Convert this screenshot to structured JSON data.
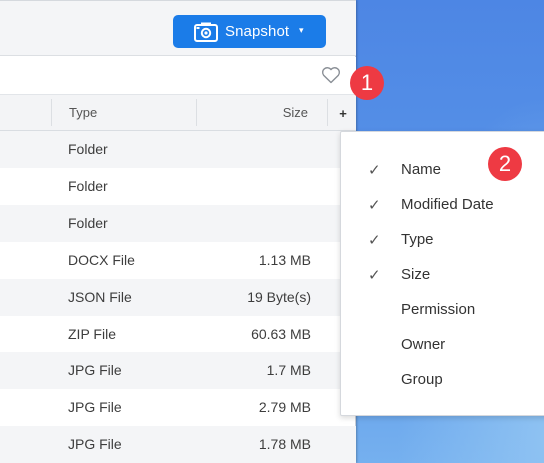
{
  "toolbar": {
    "snapshot_label": "Snapshot",
    "snapshot_icon": "camera-icon",
    "caret": "▾"
  },
  "filterbar": {
    "favorite_icon": "heart-icon"
  },
  "columns": {
    "type": "Type",
    "size": "Size",
    "add": "+"
  },
  "rows": [
    {
      "type": "Folder",
      "size": ""
    },
    {
      "type": "Folder",
      "size": ""
    },
    {
      "type": "Folder",
      "size": ""
    },
    {
      "type": "DOCX File",
      "size": "1.13 MB"
    },
    {
      "type": "JSON File",
      "size": "19 Byte(s)"
    },
    {
      "type": "ZIP File",
      "size": "60.63 MB"
    },
    {
      "type": "JPG File",
      "size": "1.7 MB"
    },
    {
      "type": "JPG File",
      "size": "2.79 MB"
    },
    {
      "type": "JPG File",
      "size": "1.78 MB"
    }
  ],
  "column_menu": {
    "items": [
      {
        "label": "Name",
        "checked": true
      },
      {
        "label": "Modified Date",
        "checked": true
      },
      {
        "label": "Type",
        "checked": true
      },
      {
        "label": "Size",
        "checked": true
      },
      {
        "label": "Permission",
        "checked": false
      },
      {
        "label": "Owner",
        "checked": false
      },
      {
        "label": "Group",
        "checked": false
      }
    ],
    "check_glyph": "✓"
  },
  "callouts": {
    "one": "1",
    "two": "2",
    "color": "#ee3a43"
  },
  "colors": {
    "accent": "#1b7ce8",
    "header_bg": "#f3f4f6",
    "stripe": "#f4f5f7"
  }
}
